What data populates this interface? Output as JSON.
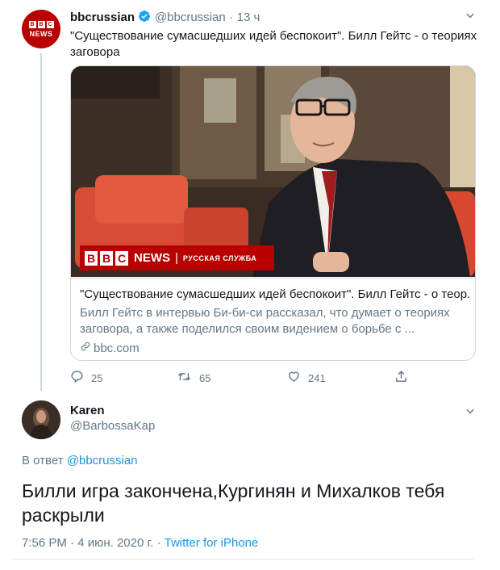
{
  "colors": {
    "brand_red": "#b80000",
    "link": "#1b95e0",
    "muted": "#657786",
    "text": "#14171a"
  },
  "tweet": {
    "author_name": "bbcrussian",
    "author_handle": "@bbcrussian",
    "separator": "·",
    "time": "13 ч",
    "avatar": {
      "blocks": [
        "B",
        "B",
        "C"
      ],
      "word": "NEWS"
    },
    "text_line1": "\"Существование сумасшедших идей беспокоит\". Билл Гейтс - о теориях",
    "text_line2": "заговора",
    "card": {
      "image_logo_blocks": [
        "B",
        "B",
        "C"
      ],
      "image_logo_news": "NEWS",
      "image_logo_service": "РУССКАЯ СЛУЖБА",
      "title": "\"Существование сумасшедших идей беспокоит\". Билл Гейтс - о теор...",
      "desc_line1": "Билл Гейтс в интервью Би-би-си рассказал, что думает о теориях",
      "desc_line2": "заговора, а также поделился своим видением о борьбе с ...",
      "domain": "bbc.com"
    },
    "actions": {
      "replies": "25",
      "retweets": "65",
      "likes": "241"
    }
  },
  "reply": {
    "author_name": "Karen",
    "author_handle": "@BarbossaKap",
    "in_reply_prefix": "В ответ",
    "in_reply_handle": "@bbcrussian",
    "text_line1": "Билли игра закончена,Кургинян и Михалков тебя",
    "text_line2": "раскрыли",
    "timestamp": "7:56 PM · 4 июн. 2020 г.",
    "dot": "·",
    "source": "Twitter for iPhone"
  },
  "icons": [
    "chevron-down-icon",
    "verified-badge-icon",
    "link-icon",
    "reply-icon",
    "retweet-icon",
    "like-icon",
    "share-icon"
  ]
}
